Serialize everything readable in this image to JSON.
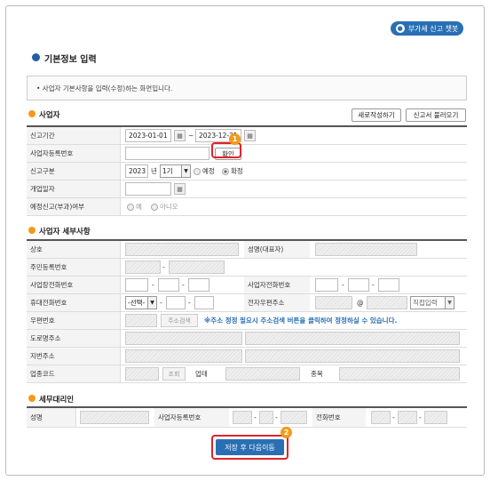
{
  "top_button": {
    "label": "부가세 신고 챗봇",
    "icon": "chatbot-icon"
  },
  "section_title": "기본정보 입력",
  "notice": "• 사업자 기본사항을 입력(수정)하는 화면입니다.",
  "business": {
    "title": "사업자",
    "new_btn": "새로작성하기",
    "load_btn": "신고서 불러오기",
    "period_label": "신고기간",
    "period_from": "2023-01-01",
    "period_sep": "~",
    "period_to": "2023-12-31",
    "regno_label": "사업자등록번호",
    "confirm_btn": "확인",
    "type_label": "신고구분",
    "year": "2023",
    "year_unit": "년",
    "term": "1기",
    "opt_prelim": "예정",
    "opt_final": "확정",
    "open_label": "개업일자",
    "prelim_label": "예정신고(부과)여부",
    "opt_yes": "예",
    "opt_no": "아니오"
  },
  "details": {
    "title": "사업자 세부사항",
    "company": "상호",
    "ceo": "성명(대표자)",
    "rrn": "주민등록번호",
    "dash": "-",
    "office_tel": "사업장전화번호",
    "biz_tel": "사업자전화번호",
    "mobile": "휴대전화번호",
    "mobile_select": "-선택-",
    "email": "전자우편주소",
    "at": "@",
    "email_select": "직접입력",
    "zip": "우편번호",
    "addr_search": "주소검색",
    "addr_note": "※주소 정정 필요시 주소검색 버튼을 클릭하여 정정하실 수 있습니다.",
    "road": "도로명주소",
    "lot": "지번주소",
    "biz_code": "업종코드",
    "lookup": "조회",
    "biz_type": "업태",
    "biz_item": "종목"
  },
  "agent": {
    "title": "세무대리인",
    "name": "성명",
    "regno": "사업자등록번호",
    "tel": "전화번호"
  },
  "save_btn": "저장 후 다음이동",
  "markers": {
    "one": "1",
    "two": "2"
  },
  "colors": {
    "accent": "#2a6fb3",
    "highlight": "#e2232a",
    "marker": "#f39a1a"
  }
}
